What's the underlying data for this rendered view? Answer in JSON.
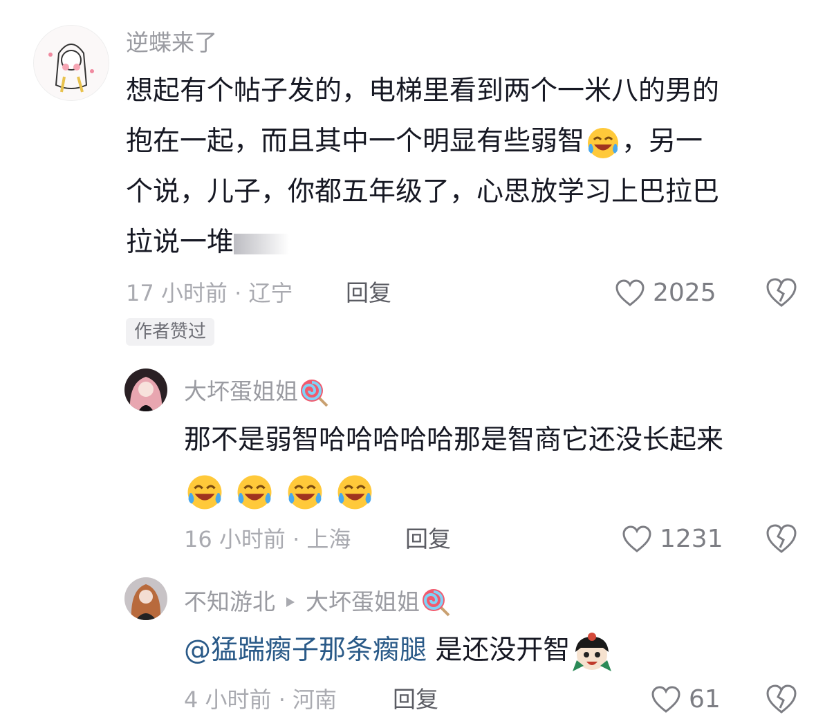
{
  "comments": [
    {
      "username": "逆蝶来了",
      "text_lines": [
        "想起有个帖子发的，电梯里看到两个一米八的男的",
        "抱在一起，而且其中一个明显有些弱智",
        "，另一",
        "个说，儿子，你都五年级了，心思放学习上巴拉巴",
        "拉说一堆"
      ],
      "time_location": "17 小时前 · 辽宁",
      "reply_label": "回复",
      "likes": "2025",
      "badge": "作者赞过"
    },
    {
      "username": "大坏蛋姐姐",
      "text": "那不是弱智哈哈哈哈哈那是智商它还没长起来",
      "time_location": "16 小时前 · 上海",
      "reply_label": "回复",
      "likes": "1231"
    },
    {
      "username": "不知游北",
      "reply_to": "大坏蛋姐姐",
      "mention": "@猛踹瘸子那条瘸腿",
      "text": " 是还没开智",
      "time_location": "4 小时前 · 河南",
      "reply_label": "回复",
      "likes": "61"
    }
  ],
  "colors": {
    "text": "#161823",
    "meta": "#a9aab0",
    "mention": "#2a5a88",
    "badge_bg": "#f1f1f3"
  },
  "icons": [
    "heart-icon",
    "broken-heart-icon",
    "laugh-cry-emoji",
    "lollipop-emoji",
    "play-arrow-icon"
  ]
}
